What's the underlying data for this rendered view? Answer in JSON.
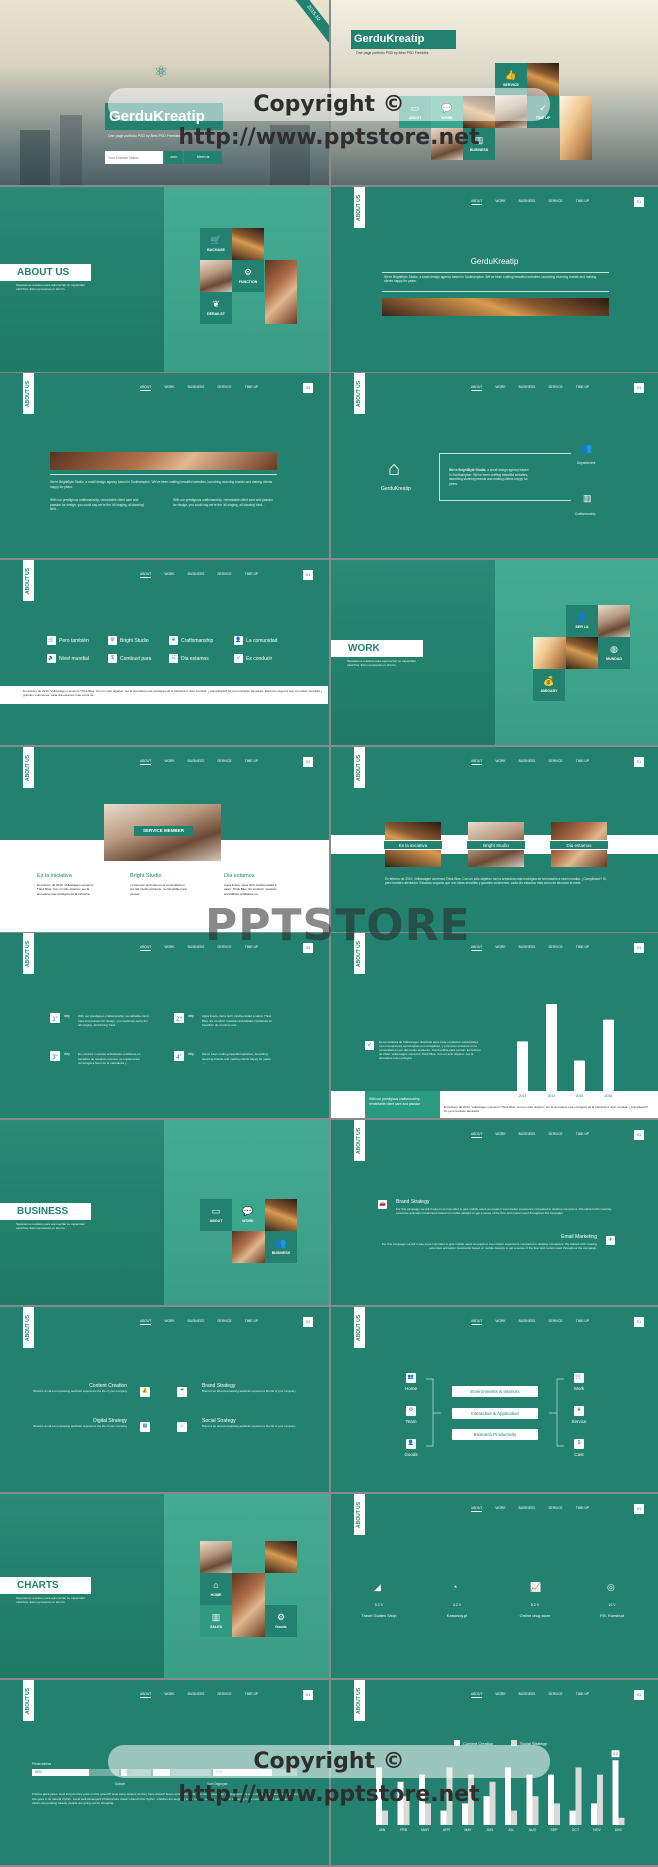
{
  "colors": {
    "primary": "#23826f",
    "light": "#3fa68e",
    "white": "#ffffff",
    "watermark": "#2e2e2e"
  },
  "watermark": {
    "copyright": "Copyright © http://www.pptstore.net",
    "logo": "PPTSTORE"
  },
  "nav": {
    "vertical_tab": "ABOUT US",
    "items": [
      "ABOUT",
      "WORK",
      "BUSINESS",
      "SERVICE",
      "TIME UP"
    ],
    "page": "01"
  },
  "hero": {
    "ribbon": "2015.10",
    "brand": "GerduKreatip",
    "subtitle": "One page portfolio PSD by Best PSD Freebies",
    "domain_placeholder": "Your Domain Name",
    "tld": ".com",
    "cta": "Meet us",
    "icon": "atom-icon"
  },
  "hero2": {
    "brand": "GerduKreatip",
    "subtitle": "One page portfolio PSD by Best PSD Freebies",
    "tiles": [
      {
        "label": "SERVICE",
        "icon": "thumbs-up-icon"
      },
      {
        "label": "ABOUT",
        "icon": "monitor-icon"
      },
      {
        "label": "WORK",
        "icon": "chat-icon"
      },
      {
        "label": "TIME UP",
        "icon": "check-circle-icon"
      },
      {
        "label": "BUSINESS",
        "icon": "bar-chart-icon"
      }
    ]
  },
  "section_desc": "Separamos residuos para aprovechar su capacidad calorífica. Esto representa un ahorro.",
  "about_cover": {
    "title": "ABOUT US",
    "tiles": [
      {
        "label": "BUCHASE",
        "icon": "cart-icon"
      },
      {
        "label": "FUNCTION",
        "icon": "gears-icon"
      },
      {
        "label": "DERAILST",
        "icon": "leaf-icon"
      }
    ]
  },
  "about_intro": {
    "title": "GerduKreatip",
    "text": "We're BrightByte Studio, a small design agency based in Southampton. We've been crafting beautiful websites, launching stunning brands and making clients happy for years."
  },
  "about_cols": {
    "text": "We're BrightByte Studio, a small design agency based in Southampton. We've been crafting beautiful websites, launching stunning brands and making clients happy for years.",
    "col1": "With our prestigious craftsmanship, remarkable client care and passion for design, you could say we're the 'all singing, all dancing' kind...",
    "col2": "With our prestigious craftsmanship, remarkable client care and passion for design, you could say we're the 'all singing, all dancing' kind..."
  },
  "about_tree": {
    "center": "GerduKreatip",
    "text_bold": "We're BrightByte Studio,",
    "text": " a small design agency based in Southampton. We've been crafting beautiful websites, launching stunning brands and making clients happy for years.",
    "top": "Departement",
    "bottom": "Craftsmanship"
  },
  "features": {
    "items": [
      {
        "label": "Pero también",
        "icon": "cart-icon"
      },
      {
        "label": "Bright Studio",
        "icon": "gears-icon"
      },
      {
        "label": "Craftsmanship",
        "icon": "leaf-icon"
      },
      {
        "label": "La comunidad",
        "icon": "user-icon"
      },
      {
        "label": "Nivel mundial",
        "icon": "speaker-icon"
      },
      {
        "label": "Combust para",
        "icon": "dollar-icon"
      },
      {
        "label": "Dia estamos",
        "icon": "sitemap-icon"
      },
      {
        "label": "Es conducir",
        "icon": "rocket-icon"
      }
    ],
    "band": "En febrero de 2010, Volkswagen comenzó Think Blue. Con un sólo objetivo: ser la armadora más ecológica de la industria a nivel mundial. ¿Complicado? Sí, pero también alentador. Estamos seguros que con ideas sencillas y grandes volumenes, cada día estamos más cerca de."
  },
  "work_cover": {
    "title": "WORK",
    "tiles": [
      {
        "label": "SER LA",
        "icon": "user-tie-icon"
      },
      {
        "label": "MUNDAD",
        "icon": "globe-icon"
      },
      {
        "label": "AMIGABY",
        "icon": "money-bag-icon"
      }
    ]
  },
  "service_member": {
    "label": "SERVICE MEMBER",
    "cols": [
      {
        "title": "Es la iniciativa",
        "text": "En febrero de 2010, Volkswagen comenzó Think Blue. Con un sólo objetivo: ser la armadora más ecológica de la industria."
      },
      {
        "title": "Bright Studio",
        "text": "y promover acciones en la comunidad en pro del medio ambiente. Combustible para pensar."
      },
      {
        "title": "Dia estamos",
        "text": "Agua limpia, tierra fértil, biodiversidad a salvo: Think Blue. Es conducir nuestras actividades cotidianas en..."
      }
    ]
  },
  "gallery": {
    "labels": [
      "Es la iniciativa",
      "Bright Studio",
      "Dia estamos"
    ],
    "text": "En febrero de 2010, Volkswagen comenzó Think Blue. Con un sólo objetivo: ser la armadora más ecológica de la industria a nivel mundial. ¿Complicado? Sí, pero también alentador. Estamos seguros que con ideas sencillas y grandes volúmenes, cada día estamos más cerca de alcanzar la meta."
  },
  "steps": [
    {
      "n": "1",
      "sfx": "st",
      "label": "step",
      "text": "With our prestigious craftsmanship, remarkable client care and passion for design, you could say we're the 'all singing, all dancing' kind..."
    },
    {
      "n": "2",
      "sfx": "nd",
      "label": "step",
      "text": "Agua limpia, tierra fértil, biodiversidad a salvo: Think Blue. Es conducir nuestras actividades cotidianas en beneficio de nosotros mis..."
    },
    {
      "n": "3",
      "sfx": "rd",
      "label": "step",
      "text": "Es conducir nuestras actividades cotidianas en beneficio de nosotros mismos, es implementar tecnología a favor de la naturaleza y..."
    },
    {
      "n": "4",
      "sfx": "th",
      "label": "step",
      "text": "We've been crafting beautiful websites, launching stunning brands and making clients happy for years. ..."
    }
  ],
  "year_bars": {
    "icon": "rocket-icon",
    "text": "Es la iniciativa de Volkswagen diseñada para crear productos sustentables con innovaciones tecnológicas eco-amigables, y promover acciones en la comunidad en pro del medio ambiente. Combustible para pensar. En febrero de 2010, Volkswagen comenzó Think Blue. Con un sólo objetivo: ser la armadora más ecológica",
    "box": "With our prestigious craftsmanship, remarkable client care and passion",
    "footer": "En febrero de 2010, Volkswagen comenzó Think Blue. Con un sólo objetivo: ser la armadora más ecológica de la industria a nivel mundial. ¿Complicado? Sí, pero también alentador"
  },
  "business_cover": {
    "title": "BUSINESS",
    "tiles": [
      {
        "label": "ABOUT",
        "icon": "monitor-icon"
      },
      {
        "label": "WORK",
        "icon": "chat-icon"
      },
      {
        "label": "BUSINESS",
        "icon": "people-icon"
      }
    ]
  },
  "business_detail": [
    {
      "title": "Brand Strategy",
      "icon": "car-icon",
      "text": "For this campaign we felt it was more important to give mobile users an equal or even better experience compared to desktop computers. We started with creating extensive animation treatments based on mobile designs to get a sense of the flow and motion used throughout the campaign."
    },
    {
      "title": "Email Marketing",
      "icon": "plane-icon",
      "text": "For this campaign we felt it was more important to give mobile users an equal or even better experience compared to desktop computers. We started with creating extensive animation treatments based on mobile designs to get a sense of the flow and motion used throughout the campaign."
    }
  ],
  "strategies": [
    {
      "title": "Content Creation",
      "icon": "money-bag-icon",
      "text": "Brand is an all-encompassing aesthetic experience the life of your company ."
    },
    {
      "title": "Brand Strategy",
      "icon": "umbrella-icon",
      "text": "Brand is an all-encompassing aesthetic experience the life of your company ."
    },
    {
      "title": "Digital Strategy",
      "icon": "calendar-icon",
      "text": "Brand is an all-encompassing aesthetic experience the life of your company ."
    },
    {
      "title": "Social Strategy",
      "icon": "home-icon",
      "text": "Brand is an all-encompassing aesthetic experience the life of your company ."
    }
  ],
  "diagram": {
    "left": [
      {
        "label": "Home",
        "icon": "people-icon"
      },
      {
        "label": "Team",
        "icon": "gears-icon"
      },
      {
        "label": "Goods",
        "icon": "user-icon"
      }
    ],
    "middle": [
      "Environments & Interiors",
      "Interactive & Application",
      "Business Productivity"
    ],
    "right": [
      {
        "label": "Work",
        "icon": "cart-icon"
      },
      {
        "label": "Service",
        "icon": "leaf-icon"
      },
      {
        "label": "Cast",
        "icon": "dollar-icon"
      }
    ]
  },
  "charts_cover": {
    "title": "CHARTS",
    "tiles": [
      {
        "label": "HOME",
        "icon": "home-icon"
      },
      {
        "label": "SALES",
        "icon": "bar-chart-icon"
      },
      {
        "label": "Goods",
        "icon": "gears-icon"
      }
    ]
  },
  "gauges": [
    {
      "value": "5.2 V",
      "label": "Travel Guides Shop",
      "icon": "stairs-chart-icon",
      "fill": 0.52
    },
    {
      "value": "3.2 V",
      "label": "Kanonicy.pl",
      "icon": "pie-icon",
      "fill": 0.32
    },
    {
      "value": "8.2 V",
      "label": "Online drug store",
      "icon": "line-chart-icon",
      "fill": 0.82
    },
    {
      "value": "10 V",
      "label": "P.B. Konsbud",
      "icon": "target-icon",
      "fill": 1.0
    }
  ],
  "progress": {
    "label": "Primevalness",
    "segments": [
      {
        "value": "65%",
        "pct": 65
      },
      {
        "value": "20%",
        "pct": 20
      },
      {
        "value": "",
        "pct": 30
      },
      {
        "value": "70%",
        "pct": 70
      }
    ],
    "sublabels": [
      "Suburb",
      "Yuri Grigoryan"
    ],
    "text": "Pristine giant pines. How long do they grow on this ground? How many winters do they have ahead? Every spring the birds fly to these woods for nesting. Spider's web shimmers between the branches. Life goes in its natural rhythm. Local well-developed infrastructure doesn't disturb this rhythm. Children are laughing in the nursery schools, nice music is playing in the restaurants and cafes, beauty salons are praising beauty, people are going out for shopping."
  },
  "chart_data": [
    {
      "type": "bar",
      "categories": [
        "2013",
        "2014",
        "2015",
        "2016"
      ],
      "values": [
        57,
        100,
        35,
        82
      ],
      "title": "",
      "xlabel": "",
      "ylabel": ""
    },
    {
      "type": "bar",
      "categories": [
        "JAN",
        "FEB",
        "MAR",
        "APR",
        "MAY",
        "JUN",
        "JUL",
        "AUG",
        "SEP",
        "OCT",
        "NOV",
        "DEC"
      ],
      "series": [
        {
          "name": "Content Creation",
          "color": "#ffffff",
          "values": [
            8,
            6,
            7,
            2,
            3,
            4,
            8,
            7,
            7,
            2,
            3,
            9
          ]
        },
        {
          "name": "Social Strategy",
          "color": "#d9d9d9",
          "values": [
            2,
            4,
            3,
            8,
            7,
            6,
            2,
            4,
            3,
            8,
            7,
            1
          ]
        }
      ],
      "data_labels": [
        {
          "category": "DEC",
          "series": "Content Creation",
          "text": "9.0"
        }
      ],
      "ylim": [
        0,
        10
      ],
      "legend": "top",
      "grid": false,
      "title": "",
      "xlabel": "",
      "ylabel": ""
    }
  ]
}
